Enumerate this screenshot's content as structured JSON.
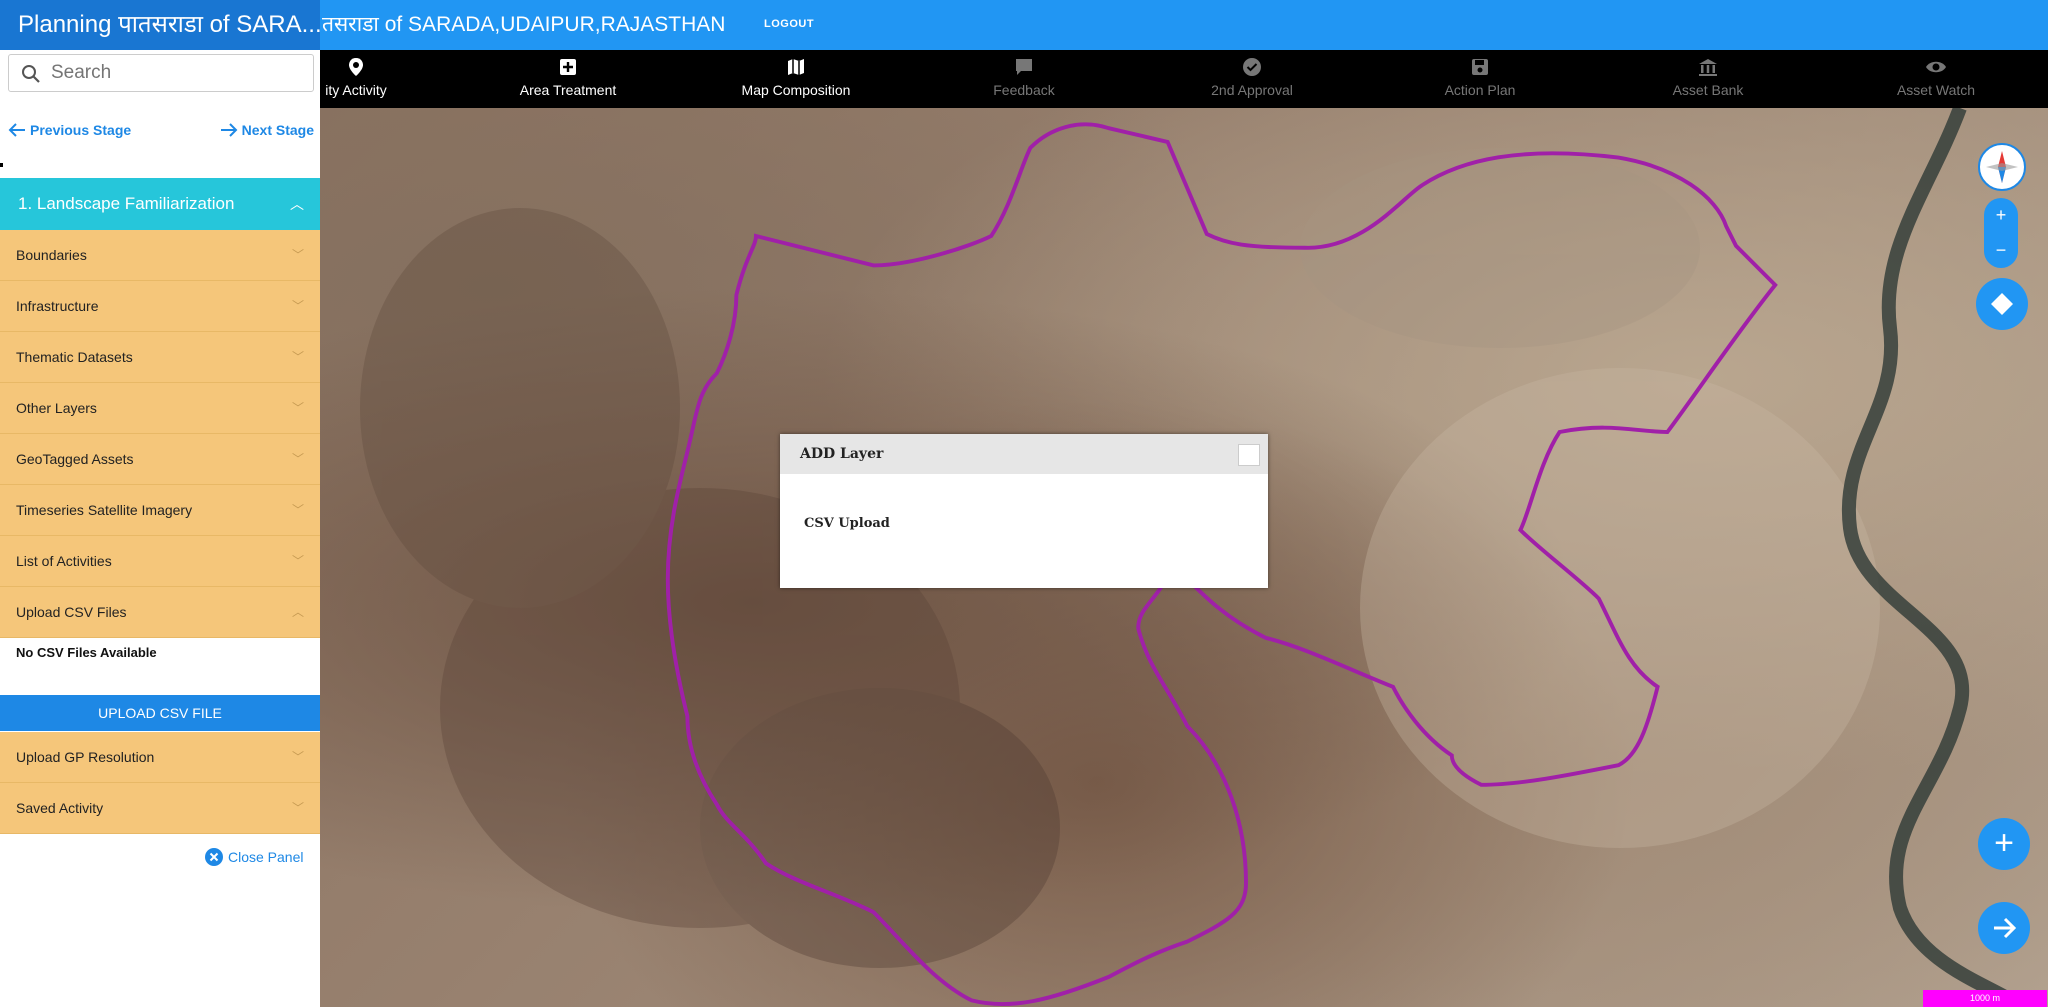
{
  "header": {
    "short_title": "Planning पातसराडा of SARA...",
    "full_title": "तसराडा of SARADA,UDAIPUR,RAJASTHAN",
    "logout_label": "LOGOUT"
  },
  "sidebar": {
    "search_placeholder": "Search",
    "prev_stage": "Previous Stage",
    "next_stage": "Next Stage",
    "stage_title": "1. Landscape Familiarization",
    "items": [
      {
        "label": "Boundaries"
      },
      {
        "label": "Infrastructure"
      },
      {
        "label": "Thematic Datasets"
      },
      {
        "label": "Other Layers"
      },
      {
        "label": "GeoTagged Assets"
      },
      {
        "label": "Timeseries Satellite Imagery"
      },
      {
        "label": "List of Activities"
      },
      {
        "label": "Upload CSV Files"
      }
    ],
    "csv_empty": "No CSV Files Available",
    "upload_button": "UPLOAD CSV FILE",
    "items2": [
      {
        "label": "Upload GP Resolution"
      },
      {
        "label": "Saved Activity"
      }
    ],
    "close_panel": "Close Panel"
  },
  "toolbar": {
    "items": [
      {
        "label": "ity Activity",
        "icon": "map-pin-icon",
        "state": "active"
      },
      {
        "label": "Area Treatment",
        "icon": "plus-box-icon",
        "state": "active"
      },
      {
        "label": "Map Composition",
        "icon": "map-icon",
        "state": "active"
      },
      {
        "label": "Feedback",
        "icon": "feedback-icon",
        "state": "inactive"
      },
      {
        "label": "2nd Approval",
        "icon": "check-circle-icon",
        "state": "inactive"
      },
      {
        "label": "Action Plan",
        "icon": "save-icon",
        "state": "inactive"
      },
      {
        "label": "Asset Bank",
        "icon": "bank-icon",
        "state": "inactive"
      },
      {
        "label": "Asset Watch",
        "icon": "eye-icon",
        "state": "inactive"
      }
    ]
  },
  "dialog": {
    "title": "ADD Layer",
    "body": "CSV Upload"
  },
  "map": {
    "zoom_in": "+",
    "zoom_out": "−",
    "add_button": "+",
    "scale": "1000 m",
    "boundary_color": "#a020a8"
  }
}
